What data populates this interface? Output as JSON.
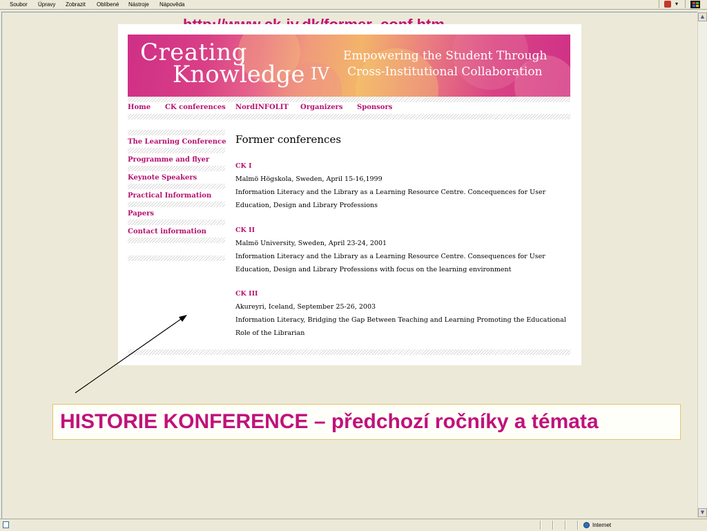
{
  "menubar": {
    "items": [
      "Soubor",
      "Úpravy",
      "Zobrazit",
      "Oblíbené",
      "Nástroje",
      "Nápověda"
    ]
  },
  "url_annotation": "http://www.ck-iv.dk/former_conf.htm",
  "banner": {
    "title_line1": "Creating",
    "title_line2": "Knowledge",
    "roman": "IV",
    "tagline1": "Empowering the Student Through",
    "tagline2": "Cross-Institutional Collaboration"
  },
  "top_nav": [
    "Home",
    "CK conferences",
    "NordINFOLIT",
    "Organizers",
    "Sponsors"
  ],
  "sidebar": [
    "The Learning Conference",
    "Programme and flyer",
    "Keynote Speakers",
    "Practical Information",
    "Papers",
    "Contact information"
  ],
  "content": {
    "heading": "Former conferences",
    "conferences": [
      {
        "name": "CK I",
        "place": "Malmö Högskola, Sweden, April 15-16,1999",
        "topic": "Information Literacy and the Library as a Learning Resource Centre. Concequences for User Education, Design and Library Professions"
      },
      {
        "name": "CK II",
        "place": "Malmö University, Sweden, April 23-24, 2001",
        "topic": "Information Literacy and the Library as a Learning Resource Centre. Consequences for User Education, Design and Library Professions with focus on the learning environment"
      },
      {
        "name": "CK III",
        "place": "Akureyri, Iceland, September 25-26, 2003",
        "topic": "Information Literacy, Bridging the Gap Between Teaching and Learning Promoting the Educational Role of the Librarian"
      }
    ]
  },
  "caption": "HISTORIE KONFERENCE – předchozí ročníky a témata",
  "statusbar": {
    "zone": "Internet"
  },
  "colors": {
    "accent": "#c0127a",
    "link": "#b5116f"
  }
}
